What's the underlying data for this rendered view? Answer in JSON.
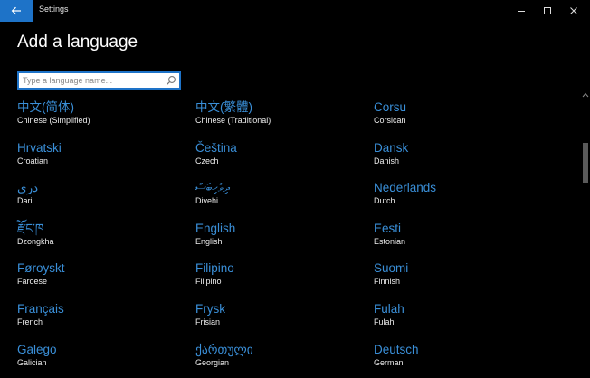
{
  "window": {
    "title": "Settings",
    "minimize_icon": "minimize-icon",
    "maximize_icon": "maximize-icon",
    "close_icon": "close-icon",
    "accent_color": "#1e73c8",
    "back_icon": "back-arrow-icon"
  },
  "page": {
    "title": "Add a language"
  },
  "search": {
    "placeholder": "Type a language name...",
    "value": "",
    "icon": "search-icon"
  },
  "languages": [
    {
      "native": "中文(简体)",
      "english": "Chinese (Simplified)"
    },
    {
      "native": "中文(繁體)",
      "english": "Chinese (Traditional)"
    },
    {
      "native": "Corsu",
      "english": "Corsican"
    },
    {
      "native": "Hrvatski",
      "english": "Croatian"
    },
    {
      "native": "Čeština",
      "english": "Czech"
    },
    {
      "native": "Dansk",
      "english": "Danish"
    },
    {
      "native": "دری",
      "english": "Dari"
    },
    {
      "native": "ދިވެހިބަސް",
      "english": "Divehi"
    },
    {
      "native": "Nederlands",
      "english": "Dutch"
    },
    {
      "native": "རྫོང་ཁ",
      "english": "Dzongkha"
    },
    {
      "native": "English",
      "english": "English"
    },
    {
      "native": "Eesti",
      "english": "Estonian"
    },
    {
      "native": "Føroyskt",
      "english": "Faroese"
    },
    {
      "native": "Filipino",
      "english": "Filipino"
    },
    {
      "native": "Suomi",
      "english": "Finnish"
    },
    {
      "native": "Français",
      "english": "French"
    },
    {
      "native": "Frysk",
      "english": "Frisian"
    },
    {
      "native": "Fulah",
      "english": "Fulah"
    },
    {
      "native": "Galego",
      "english": "Galician"
    },
    {
      "native": "ქართული",
      "english": "Georgian"
    },
    {
      "native": "Deutsch",
      "english": "German"
    }
  ]
}
